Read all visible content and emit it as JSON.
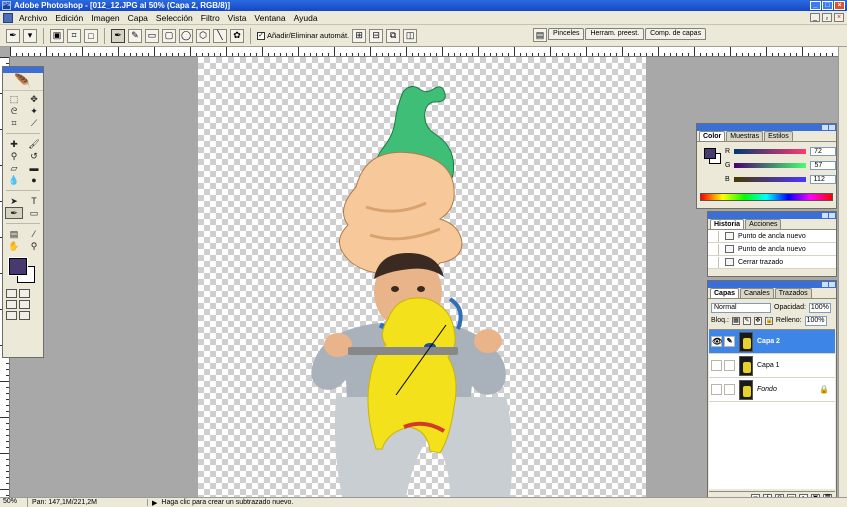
{
  "window": {
    "title": "Adobe Photoshop - [012_12.JPG al 50% (Capa 2, RGB/8)]",
    "controls": [
      "_",
      "□",
      "×"
    ]
  },
  "menu": {
    "items": [
      "Archivo",
      "Edición",
      "Imagen",
      "Capa",
      "Selección",
      "Filtro",
      "Vista",
      "Ventana",
      "Ayuda"
    ],
    "doc_controls": [
      "_",
      "₂",
      "×"
    ]
  },
  "options": {
    "auto_add_delete_label": "Añadir/Eliminar automát.",
    "auto_add_delete_checked": "✓"
  },
  "palette_well": {
    "tabs": [
      "Pinceles",
      "Herram. preest.",
      "Comp. de capas"
    ]
  },
  "color_palette": {
    "tabs": [
      "Color",
      "Muestras",
      "Estilos"
    ],
    "foreground": "#483970",
    "r_label": "R",
    "r_value": "72",
    "g_label": "G",
    "g_value": "57",
    "b_label": "B",
    "b_value": "112"
  },
  "history_palette": {
    "tabs": [
      "Historia",
      "Acciones"
    ],
    "items": [
      "Punto de ancla nuevo",
      "Punto de ancla nuevo",
      "Cerrar trazado"
    ]
  },
  "layers_palette": {
    "tabs": [
      "Capas",
      "Canales",
      "Trazados"
    ],
    "blend_mode": "Normal",
    "opacity_label": "Opacidad:",
    "opacity_value": "100%",
    "lock_label": "Bloq.:",
    "fill_label": "Relleno:",
    "fill_value": "100%",
    "layers": [
      {
        "name": "Capa 2",
        "selected": true
      },
      {
        "name": "Capa 1",
        "selected": false
      },
      {
        "name": "Fondo",
        "selected": false
      }
    ]
  },
  "status": {
    "zoom": "50%",
    "doc_size": "Pan: 147,1M/221,2M",
    "hint": "Haga clic para crear un subtrazado nuevo."
  },
  "colors": {
    "foreground": "#483970",
    "background": "#ffffff",
    "selected_layer": "#3d86e8",
    "titlebar": "#2b6be0"
  },
  "icons": [
    "pen-tool-icon",
    "marquee-tool-icon",
    "move-tool-icon",
    "lasso-tool-icon",
    "magic-wand-icon",
    "crop-tool-icon",
    "slice-tool-icon",
    "healing-brush-icon",
    "brush-tool-icon",
    "stamp-tool-icon",
    "history-brush-icon",
    "eraser-tool-icon",
    "gradient-tool-icon",
    "blur-tool-icon",
    "dodge-tool-icon",
    "path-selection-icon",
    "type-tool-icon",
    "pen-tool-icon",
    "shape-tool-icon",
    "notes-tool-icon",
    "eyedropper-icon",
    "hand-tool-icon",
    "zoom-tool-icon",
    "eye-icon",
    "brush-link-icon",
    "lock-icon"
  ]
}
